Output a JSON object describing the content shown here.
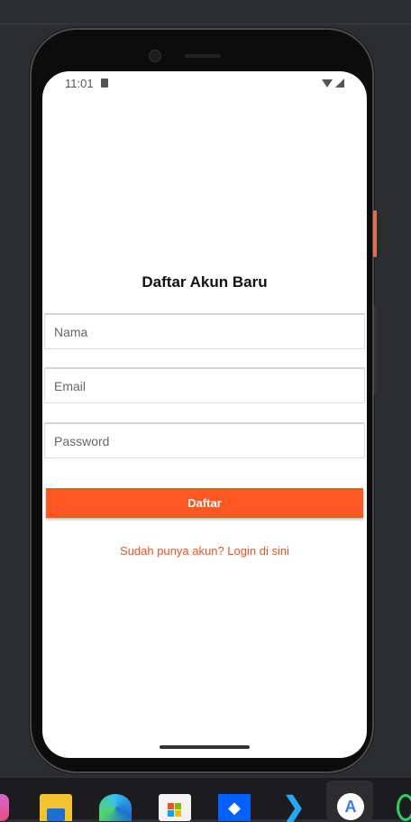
{
  "status_bar": {
    "time": "11:01"
  },
  "form": {
    "title": "Daftar Akun Baru",
    "name_placeholder": "Nama",
    "email_placeholder": "Email",
    "password_placeholder": "Password",
    "submit_label": "Daftar",
    "login_link": "Sudah punya akun? Login di sini"
  },
  "colors": {
    "accent": "#ff5722",
    "link": "#e4552a"
  },
  "taskbar": {
    "icons": [
      "app-icon",
      "file-explorer-icon",
      "edge-icon",
      "microsoft-store-icon",
      "dropbox-icon",
      "vscode-icon",
      "android-studio-icon",
      "whatsapp-icon"
    ]
  }
}
